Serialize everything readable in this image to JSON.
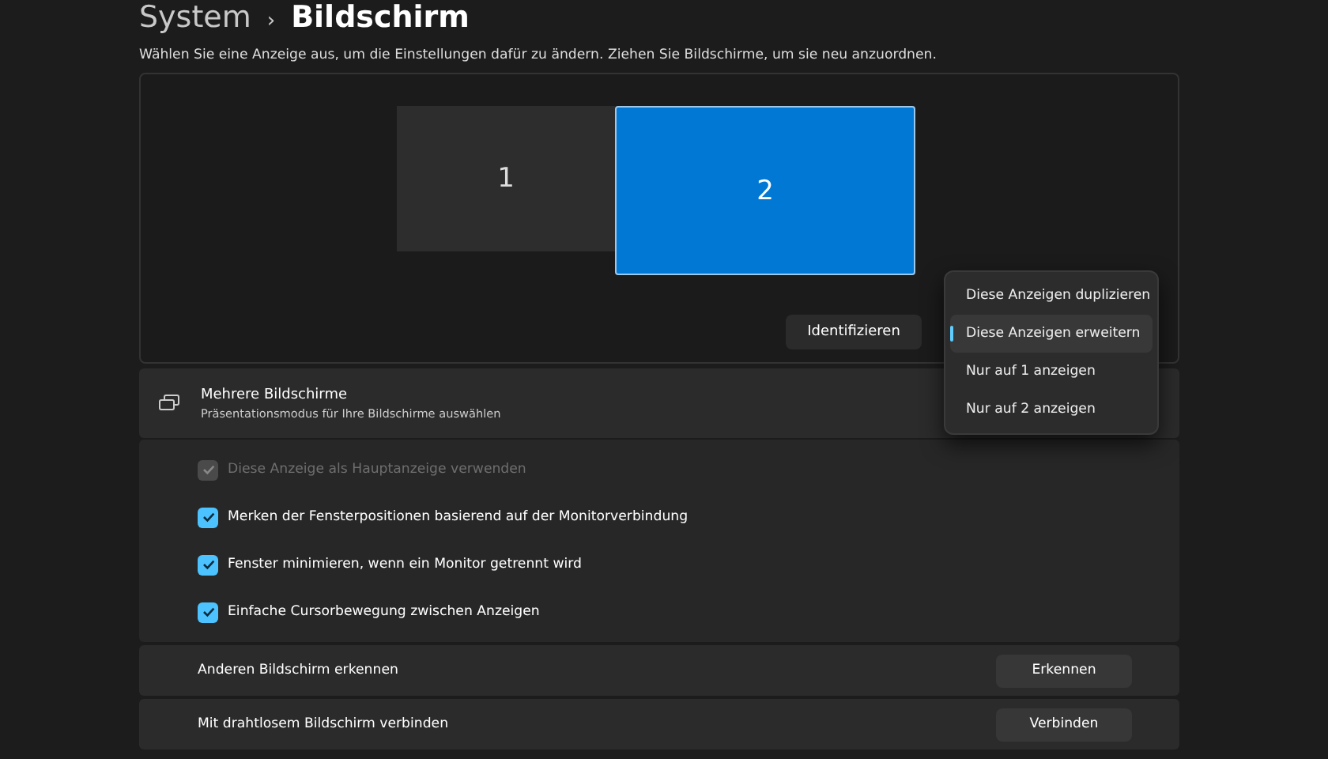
{
  "breadcrumb": {
    "parent": "System",
    "separator": "›",
    "current": "Bildschirm"
  },
  "description": "Wählen Sie eine Anzeige aus, um die Einstellungen dafür zu ändern. Ziehen Sie Bildschirme, um sie neu anzuordnen.",
  "monitors": [
    {
      "label": "1",
      "selected": false
    },
    {
      "label": "2",
      "selected": true
    }
  ],
  "identify_button": "Identifizieren",
  "mode_menu": [
    {
      "label": "Diese Anzeigen duplizieren",
      "selected": false
    },
    {
      "label": "Diese Anzeigen erweitern",
      "selected": true
    },
    {
      "label": "Nur auf 1 anzeigen",
      "selected": false
    },
    {
      "label": "Nur auf 2 anzeigen",
      "selected": false
    }
  ],
  "multiple_displays": {
    "title": "Mehrere Bildschirme",
    "subtitle": "Präsentationsmodus für Ihre Bildschirme auswählen"
  },
  "options": [
    {
      "label": "Diese Anzeige als Hauptanzeige verwenden",
      "checked": true,
      "disabled": true
    },
    {
      "label": "Merken der Fensterpositionen basierend auf der Monitorverbindung",
      "checked": true,
      "disabled": false
    },
    {
      "label": "Fenster minimieren, wenn ein Monitor getrennt wird",
      "checked": true,
      "disabled": false
    },
    {
      "label": "Einfache Cursorbewegung zwischen Anzeigen",
      "checked": true,
      "disabled": false
    }
  ],
  "actions": [
    {
      "label": "Anderen Bildschirm erkennen",
      "button": "Erkennen"
    },
    {
      "label": "Mit drahtlosem Bildschirm verbinden",
      "button": "Verbinden"
    }
  ]
}
